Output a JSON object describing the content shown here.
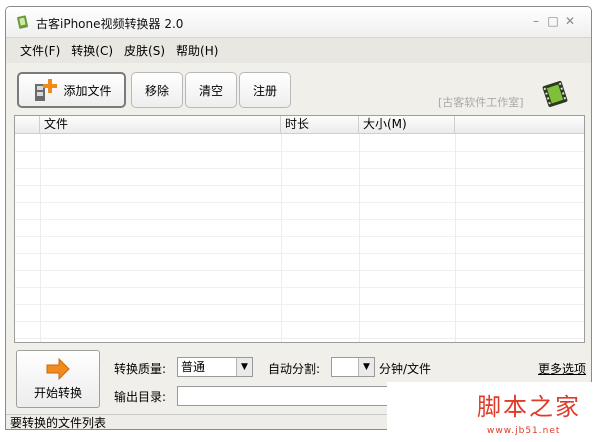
{
  "window": {
    "title": "古客iPhone视频转换器  2.0"
  },
  "menu": [
    "文件(F)",
    "转换(C)",
    "皮肤(S)",
    "帮助(H)"
  ],
  "toolbar": {
    "add_files": "添加文件",
    "remove": "移除",
    "clear": "清空",
    "register": "注册",
    "studio": "[古客软件工作室]"
  },
  "file_list": {
    "columns": [
      "文件",
      "时长",
      "大小(M)"
    ],
    "rows": []
  },
  "bottom": {
    "start_convert": "开始转换",
    "quality_label": "转换质量:",
    "quality_value": "普通",
    "auto_split_label": "自动分割:",
    "auto_split_value": "",
    "auto_split_unit": "分钟/文件",
    "more_options": "更多选项",
    "output_dir_label": "输出目录:",
    "output_dir_value": ""
  },
  "status": {
    "text": "要转换的文件列表"
  },
  "watermark": {
    "text": "脚本之家",
    "url": "www.jb51.net"
  }
}
